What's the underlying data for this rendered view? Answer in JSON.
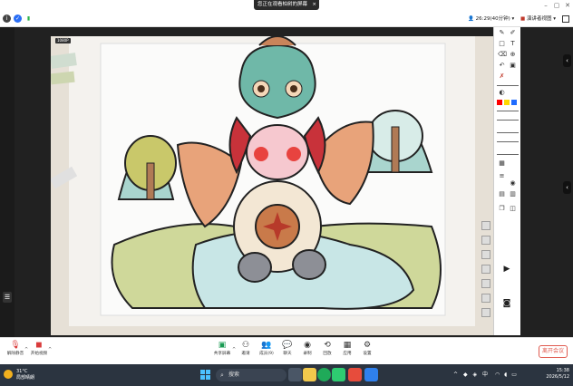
{
  "titlebar": {
    "sharing_status": "您正在观看柏树的屏幕",
    "close_label": "×"
  },
  "toolbar": {
    "timer": "26:29(40分钟)",
    "view_mode": "演讲者视图"
  },
  "annotation": {
    "colors": [
      "#ff0000",
      "#ffd800",
      "#1e6bff"
    ]
  },
  "bottom": {
    "unmute": "解除静音",
    "start_video": "开始视频",
    "share_screen": "共享屏幕",
    "host": "邀请",
    "members": "成员(9)",
    "chat": "聊天",
    "record": "录制",
    "breakout": "回放",
    "apps": "应用",
    "settings": "设置",
    "leave": "离开会议"
  },
  "taskbar": {
    "temperature": "31°C",
    "weather": "局部晴朗",
    "search": "搜索",
    "ime": "中",
    "time": "15:38",
    "date": "2026/5/12"
  },
  "stream": {
    "badge": "1080P"
  }
}
